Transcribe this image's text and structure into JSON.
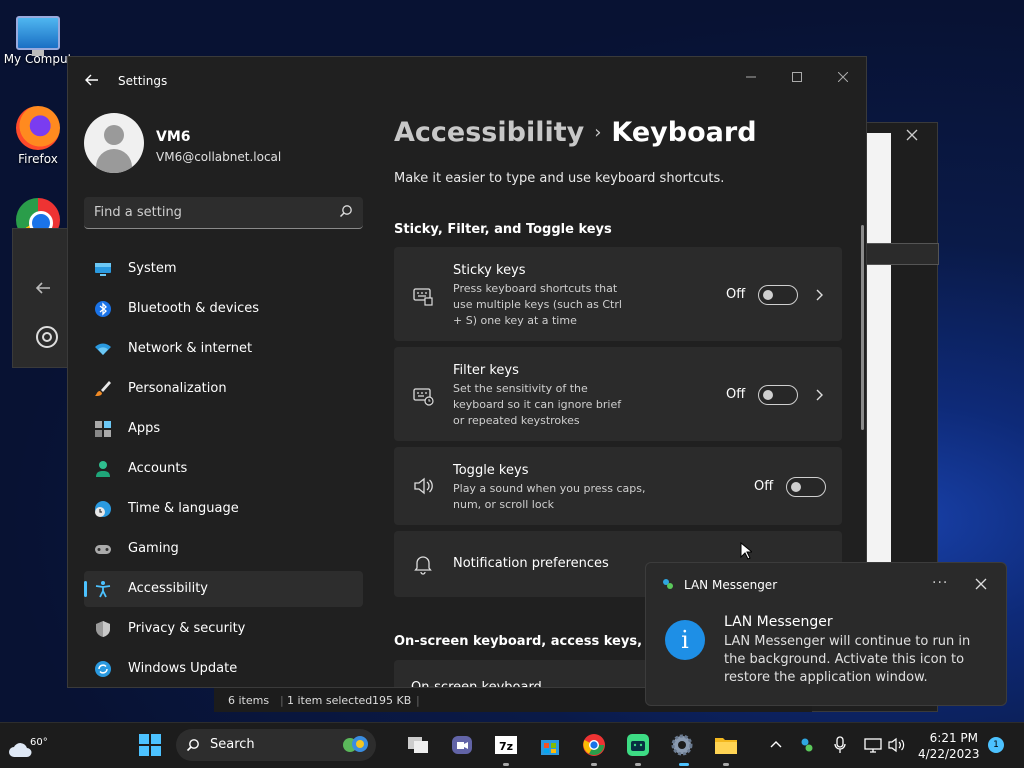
{
  "desktop": {
    "icons": [
      {
        "label": "My Comput"
      },
      {
        "label": "Firefox"
      }
    ]
  },
  "settings": {
    "title": "Settings",
    "user": {
      "name": "VM6",
      "email": "VM6@collabnet.local"
    },
    "search_placeholder": "Find a setting",
    "nav": [
      {
        "label": "System",
        "icon": "monitor-icon"
      },
      {
        "label": "Bluetooth & devices",
        "icon": "bluetooth-icon"
      },
      {
        "label": "Network & internet",
        "icon": "wifi-icon"
      },
      {
        "label": "Personalization",
        "icon": "brush-icon"
      },
      {
        "label": "Apps",
        "icon": "apps-icon"
      },
      {
        "label": "Accounts",
        "icon": "person-icon"
      },
      {
        "label": "Time & language",
        "icon": "clock-globe-icon"
      },
      {
        "label": "Gaming",
        "icon": "controller-icon"
      },
      {
        "label": "Accessibility",
        "icon": "accessibility-icon",
        "active": true
      },
      {
        "label": "Privacy & security",
        "icon": "shield-icon"
      },
      {
        "label": "Windows Update",
        "icon": "update-icon"
      }
    ],
    "breadcrumb": {
      "parent": "Accessibility",
      "separator": "›",
      "current": "Keyboard"
    },
    "subtitle": "Make it easier to type and use keyboard shortcuts.",
    "sections": [
      {
        "heading": "Sticky, Filter, and Toggle keys"
      },
      {
        "heading": "On-screen keyboard, access keys, and Pr"
      }
    ],
    "cards": [
      {
        "title": "Sticky keys",
        "desc": "Press keyboard shortcuts that use multiple keys (such as Ctrl + S) one key at a time",
        "state": "Off",
        "icon": "sticky-keys-icon",
        "has_chevron": true
      },
      {
        "title": "Filter keys",
        "desc": "Set the sensitivity of the keyboard so it can ignore brief or repeated keystrokes",
        "state": "Off",
        "icon": "filter-keys-icon",
        "has_chevron": true
      },
      {
        "title": "Toggle keys",
        "desc": "Play a sound when you press caps, num, or scroll lock",
        "state": "Off",
        "icon": "speaker-icon",
        "has_chevron": false
      },
      {
        "title": "Notification preferences",
        "icon": "bell-icon"
      },
      {
        "title": "On-screen keyboard"
      }
    ]
  },
  "toast": {
    "app_name": "LAN Messenger",
    "title": "LAN Messenger",
    "body": "LAN Messenger will continue to run in the background. Activate this icon to restore the application window.",
    "more": "···"
  },
  "explorer_status": {
    "items": "6 items",
    "selected": "1 item selected",
    "size": "195 KB"
  },
  "taskbar": {
    "weather_temp": "60°",
    "search_label": "Search",
    "time": "6:21 PM",
    "date": "4/22/2023",
    "notification_count": "1",
    "apps": [
      "start-icon",
      "widgets-icon",
      "task-view-icon",
      "meet-icon",
      "7zip-icon",
      "store-icon",
      "chrome-icon",
      "android-icon",
      "settings-icon",
      "file-explorer-icon"
    ]
  },
  "colors": {
    "accent": "#4cc2ff",
    "toast_info": "#1e8fe6"
  }
}
